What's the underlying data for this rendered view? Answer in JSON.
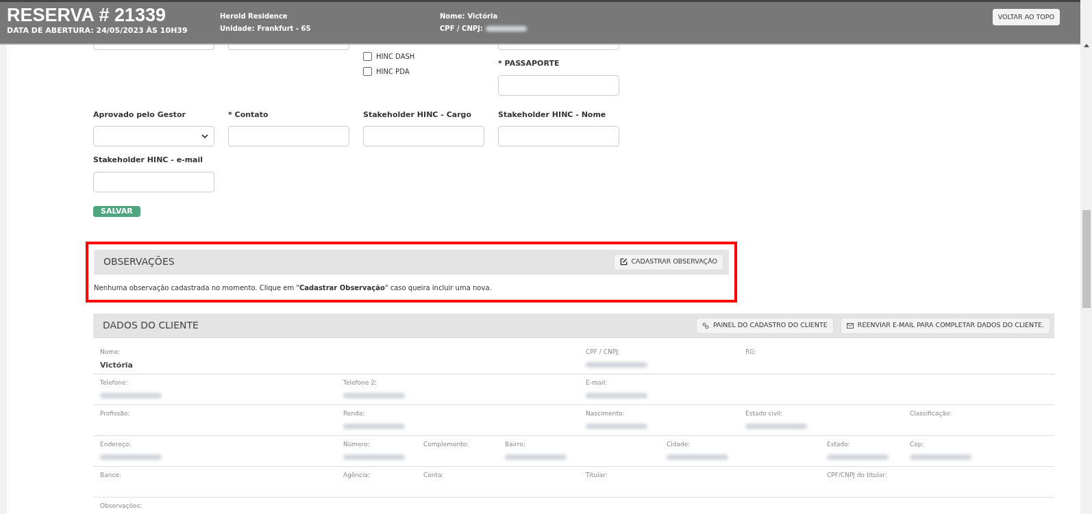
{
  "header": {
    "title": "RESERVA # 21339",
    "subtitle": "DATA DE ABERTURA: 24/05/2023 ÀS 10H39",
    "info": [
      {
        "lines": [
          {
            "value": "Herold Residence"
          },
          {
            "label": "Unidade:",
            "value": "Frankfurt - 65"
          }
        ]
      },
      {
        "lines": [
          {
            "label": "Nome:",
            "value": "Victória"
          },
          {
            "label": "CPF / CNPJ:",
            "redacted": true
          }
        ]
      }
    ],
    "back_button": "VOLTAR AO TOPO"
  },
  "form_top": {
    "products": [
      {
        "label": "HINC DASH",
        "checked": false
      },
      {
        "label": "HINC PDA",
        "checked": false
      }
    ],
    "passport_label": "* PASSAPORTE"
  },
  "form_fields": [
    {
      "label": "Aprovado pelo Gestor",
      "kind": "select"
    },
    {
      "label": "* Contato",
      "kind": "text"
    },
    {
      "label": "Stakeholder HINC - Cargo",
      "kind": "text"
    },
    {
      "label": "Stakeholder HINC - Nome",
      "kind": "text"
    },
    {
      "label": "Stakeholder HINC - e-mail",
      "kind": "text"
    }
  ],
  "save_button": "SALVAR",
  "observations": {
    "title": "OBSERVAÇÕES",
    "button": "CADASTRAR OBSERVAÇÃO",
    "highlighted": true,
    "message": "Nenhuma observação cadastrada no momento. Clique em \"**Cadastrar Observação**\" caso queira incluir uma nova."
  },
  "client": {
    "title": "DADOS DO CLIENTE",
    "buttons": [
      {
        "label": "PAINEL DO CADASTRO DO CLIENTE",
        "kind": "link"
      },
      {
        "label": "REENVIAR E-MAIL PARA COMPLETAR DADOS DO CLIENTE.",
        "kind": "mail"
      }
    ],
    "sections": [
      {
        "fields": [
          {
            "label": "Nome:",
            "value": "Victória"
          },
          {
            "label": "CPF / CNPJ:",
            "redacted": true
          },
          {
            "label": "RG:"
          }
        ]
      },
      {
        "fields": [
          {
            "label": "Telefone:",
            "redacted": true
          },
          {
            "label": "Telefone 2:",
            "redacted": true
          },
          {
            "label": "E-mail:",
            "redacted": true
          }
        ]
      },
      {
        "fields": [
          {
            "label": "Profissão:"
          },
          {
            "label": "Renda:",
            "redacted": true
          },
          {
            "label": "Nascimento:",
            "redacted": true
          },
          {
            "label": "Estado civil:",
            "redacted": true
          },
          {
            "label": "Classificação:"
          }
        ]
      },
      {
        "fields": [
          {
            "label": "Endereço:",
            "redacted": true
          },
          {
            "label": "Número:",
            "redacted": true
          },
          {
            "label": "Complemento:"
          },
          {
            "label": "Bairro:",
            "redacted": true
          },
          {
            "label": "Cidade:",
            "redacted": true
          },
          {
            "label": "Estado:",
            "redacted": true
          },
          {
            "label": "Cep:",
            "redacted": true
          }
        ]
      },
      {
        "fields": [
          {
            "label": "Banco:"
          },
          {
            "label": "Agência:"
          },
          {
            "label": "Conta:"
          },
          {
            "label": "Titular:"
          },
          {
            "label": "CPF/CNPJ do titular:"
          }
        ]
      },
      {
        "fields": [
          {
            "label": "Observações:"
          }
        ]
      }
    ]
  }
}
